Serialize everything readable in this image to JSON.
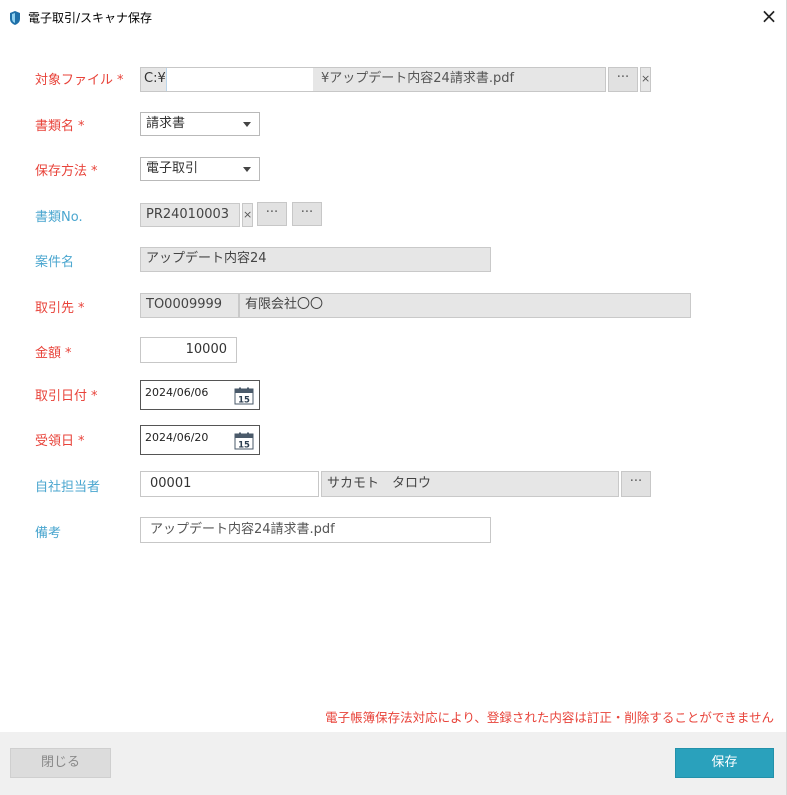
{
  "window": {
    "title": "電子取引/スキャナ保存",
    "close_glyph": "×"
  },
  "form": {
    "target_file": {
      "label": "対象ファイル",
      "prefix": "C:¥",
      "value": "¥アップデート内容24請求書.pdf",
      "browse": "···",
      "clear": "×"
    },
    "doc_type": {
      "label": "書類名",
      "value": "請求書"
    },
    "save_method": {
      "label": "保存方法",
      "value": "電子取引"
    },
    "doc_no": {
      "label": "書類No.",
      "value": "PR24010003",
      "clear": "×",
      "browse1": "···",
      "browse2": "···"
    },
    "project": {
      "label": "案件名",
      "value": "アップデート内容24"
    },
    "partner": {
      "label": "取引先",
      "code": "TO0009999",
      "name": "有限会社〇〇"
    },
    "amount": {
      "label": "金額",
      "value": "10000"
    },
    "trade_date": {
      "label": "取引日付",
      "value": "2024/06/06",
      "icon_day": "15"
    },
    "receipt_date": {
      "label": "受領日",
      "value": "2024/06/20",
      "icon_day": "15"
    },
    "staff": {
      "label": "自社担当者",
      "code": "00001",
      "name": "サカモト　タロウ",
      "browse": "···"
    },
    "remarks": {
      "label": "備考",
      "value": "アップデート内容24請求書.pdf"
    },
    "required_mark": "*"
  },
  "notice": "電子帳簿保存法対応により、登録された内容は訂正・削除することができません",
  "buttons": {
    "close": "閉じる",
    "save": "保存"
  },
  "colors": {
    "required": "#e8433a",
    "optional": "#4aa6cf",
    "primary": "#2aa1bc"
  }
}
